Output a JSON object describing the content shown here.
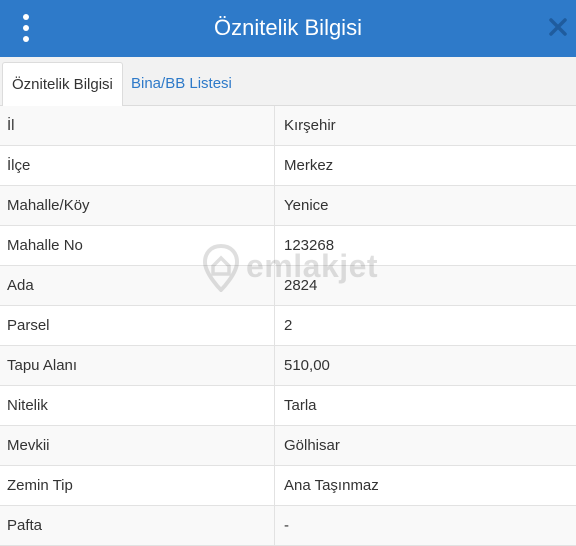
{
  "header": {
    "title": "Öznitelik Bilgisi",
    "menu_icon": "vertical-dots-icon",
    "close_icon": "close-icon",
    "background_color": "#2e7ac9"
  },
  "tabs": [
    {
      "label": "Öznitelik Bilgisi",
      "active": true
    },
    {
      "label": "Bina/BB Listesi",
      "active": false
    }
  ],
  "attributes": [
    {
      "label": "İl",
      "value": "Kırşehir"
    },
    {
      "label": "İlçe",
      "value": "Merkez"
    },
    {
      "label": "Mahalle/Köy",
      "value": "Yenice"
    },
    {
      "label": "Mahalle No",
      "value": "123268"
    },
    {
      "label": "Ada",
      "value": "2824"
    },
    {
      "label": "Parsel",
      "value": "2"
    },
    {
      "label": "Tapu Alanı",
      "value": "510,00"
    },
    {
      "label": "Nitelik",
      "value": "Tarla"
    },
    {
      "label": "Mevkii",
      "value": "Gölhisar"
    },
    {
      "label": "Zemin Tip",
      "value": "Ana Taşınmaz"
    },
    {
      "label": "Pafta",
      "value": "-"
    }
  ],
  "watermark": {
    "text": "emlakjet",
    "icon": "location-pin-icon"
  }
}
